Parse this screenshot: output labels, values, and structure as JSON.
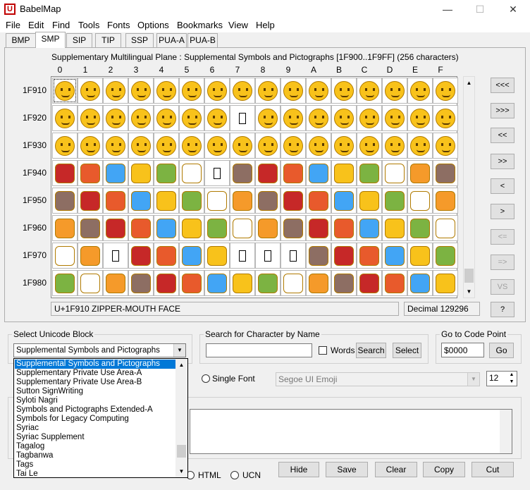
{
  "window": {
    "title": "BabelMap",
    "app_icon": "U"
  },
  "menu": [
    "File",
    "Edit",
    "Find",
    "Tools",
    "Fonts",
    "Options",
    "Bookmarks",
    "View",
    "Help"
  ],
  "tabs": [
    "BMP",
    "SMP",
    "SIP",
    "TIP",
    "SSP",
    "PUA-A",
    "PUA-B"
  ],
  "active_tab": "SMP",
  "grid": {
    "title": "Supplementary Multilingual Plane : Supplemental Symbols and Pictographs [1F900..1F9FF] (256 characters)",
    "col_headers": [
      "0",
      "1",
      "2",
      "3",
      "4",
      "5",
      "6",
      "7",
      "8",
      "9",
      "A",
      "B",
      "C",
      "D",
      "E",
      "F"
    ],
    "row_headers": [
      "1F910",
      "1F920",
      "1F930",
      "1F940",
      "1F950",
      "1F960",
      "1F970",
      "1F980"
    ],
    "missing_cells": [
      [
        1,
        7
      ],
      [
        3,
        6
      ],
      [
        6,
        2
      ],
      [
        6,
        7
      ],
      [
        6,
        8
      ],
      [
        6,
        9
      ]
    ],
    "object_rows_start": 3
  },
  "nav_buttons": [
    "<<<",
    ">>>",
    "<<",
    ">>",
    "<",
    ">",
    "<=",
    "=>",
    "VS",
    "?"
  ],
  "status": {
    "char_info": "U+1F910 ZIPPER-MOUTH FACE",
    "decimal": "Decimal 129296"
  },
  "unicode_block": {
    "label": "Select Unicode Block",
    "selected": "Supplemental Symbols and Pictographs",
    "list": [
      "Supplemental Symbols and Pictographs",
      "Supplementary Private Use Area-A",
      "Supplementary Private Use Area-B",
      "Sutton SignWriting",
      "Syloti Nagri",
      "Symbols and Pictographs Extended-A",
      "Symbols for Legacy Computing",
      "Syriac",
      "Syriac Supplement",
      "Tagalog",
      "Tagbanwa",
      "Tags",
      "Tai Le"
    ]
  },
  "search": {
    "label": "Search for Character by Name",
    "value": "",
    "words_label": "Words",
    "search_button": "Search",
    "select_button": "Select"
  },
  "goto": {
    "label": "Go to Code Point",
    "value": "$0000",
    "go_button": "Go"
  },
  "font": {
    "single_font_label": "Single Font",
    "font_name": "Segoe UI Emoji",
    "font_size": "12"
  },
  "format": {
    "html_label": "HTML",
    "ucn_label": "UCN"
  },
  "actions": {
    "hide": "Hide",
    "save": "Save",
    "clear": "Clear",
    "copy": "Copy",
    "cut": "Cut"
  }
}
